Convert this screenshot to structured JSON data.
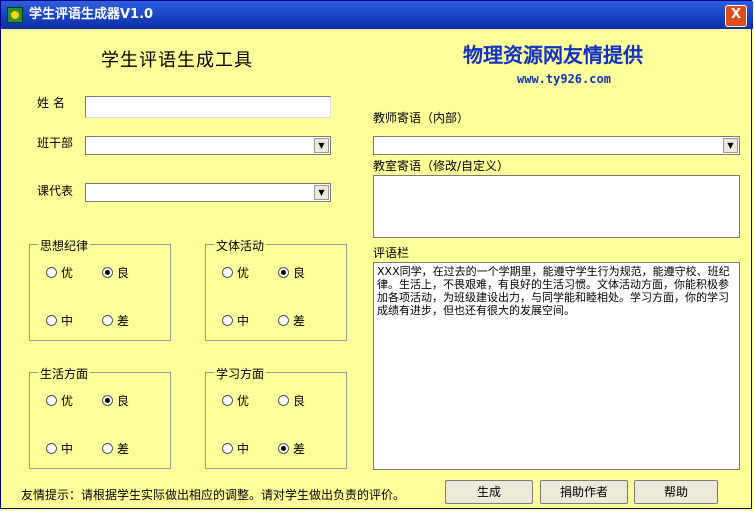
{
  "window": {
    "title": "学生评语生成器V1.0",
    "close_label": "X"
  },
  "header": {
    "app_title": "学生评语生成工具",
    "brand": "物理资源网友情提供",
    "url": "www.ty926.com"
  },
  "form": {
    "name_label": "姓  名",
    "name_value": "",
    "cadre_label": "班干部",
    "cadre_value": "",
    "course_label": "课代表",
    "course_value": ""
  },
  "groups": [
    {
      "title": "思想纪律",
      "options": [
        "优",
        "良",
        "中",
        "差"
      ],
      "selected": "良"
    },
    {
      "title": "文体活动",
      "options": [
        "优",
        "良",
        "中",
        "差"
      ],
      "selected": "良"
    },
    {
      "title": "生活方面",
      "options": [
        "优",
        "良",
        "中",
        "差"
      ],
      "selected": "良"
    },
    {
      "title": "学习方面",
      "options": [
        "优",
        "良",
        "中",
        "差"
      ],
      "selected": "差"
    }
  ],
  "right": {
    "teacher_msg_label": "教师寄语（内部）",
    "teacher_msg_value": "",
    "class_msg_label": "教室寄语（修改/自定义）",
    "class_msg_value": "",
    "comment_label": "评语栏",
    "comment_text": "XXX同学，在过去的一个学期里，能遵守学生行为规范，能遵守校、班纪律。生活上，不畏艰难，有良好的生活习惯。文体活动方面，你能积极参加各项活动，为班级建设出力，与同学能和睦相处。学习方面，你的学习成绩有进步，但也还有很大的发展空间。"
  },
  "footer": {
    "hint": "友情提示：请根据学生实际做出相应的调整。请对学生做出负责的评价。",
    "generate_label": "生成",
    "donate_label": "捐助作者",
    "help_label": "帮助"
  }
}
